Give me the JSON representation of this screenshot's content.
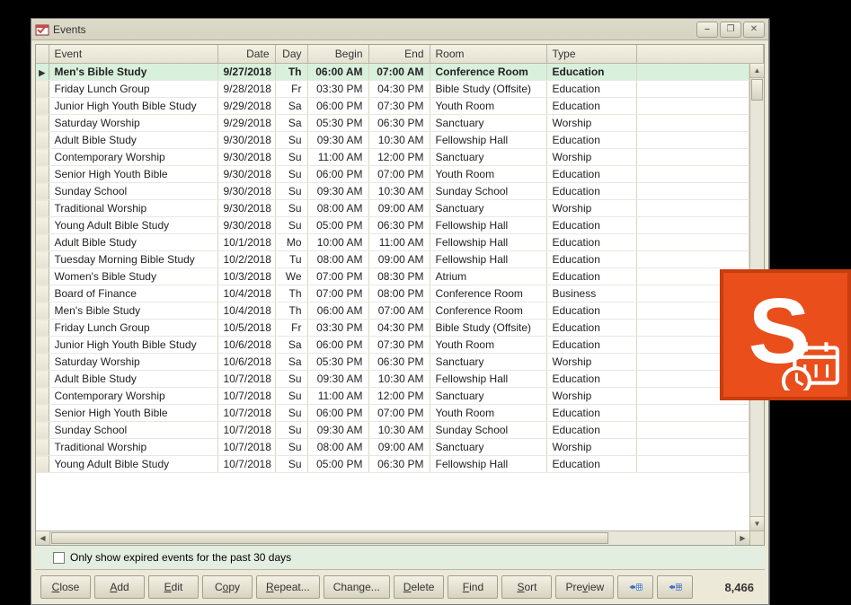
{
  "window": {
    "title": "Events",
    "controls": {
      "minimize": "⎯",
      "maximize": "❐",
      "close": "✕"
    }
  },
  "columns": {
    "event": "Event",
    "date": "Date",
    "day": "Day",
    "begin": "Begin",
    "end": "End",
    "room": "Room",
    "type": "Type"
  },
  "rows": [
    {
      "event": "Men's Bible Study",
      "date": "9/27/2018",
      "day": "Th",
      "begin": "06:00 AM",
      "end": "07:00 AM",
      "room": "Conference Room",
      "type": "Education",
      "selected": true
    },
    {
      "event": "Friday Lunch Group",
      "date": "9/28/2018",
      "day": "Fr",
      "begin": "03:30 PM",
      "end": "04:30 PM",
      "room": "Bible Study (Offsite)",
      "type": "Education"
    },
    {
      "event": "Junior High Youth Bible Study",
      "date": "9/29/2018",
      "day": "Sa",
      "begin": "06:00 PM",
      "end": "07:30 PM",
      "room": "Youth Room",
      "type": "Education"
    },
    {
      "event": "Saturday Worship",
      "date": "9/29/2018",
      "day": "Sa",
      "begin": "05:30 PM",
      "end": "06:30 PM",
      "room": "Sanctuary",
      "type": "Worship"
    },
    {
      "event": "Adult Bible Study",
      "date": "9/30/2018",
      "day": "Su",
      "begin": "09:30 AM",
      "end": "10:30 AM",
      "room": "Fellowship Hall",
      "type": "Education"
    },
    {
      "event": "Contemporary Worship",
      "date": "9/30/2018",
      "day": "Su",
      "begin": "11:00 AM",
      "end": "12:00 PM",
      "room": "Sanctuary",
      "type": "Worship"
    },
    {
      "event": "Senior High Youth Bible",
      "date": "9/30/2018",
      "day": "Su",
      "begin": "06:00 PM",
      "end": "07:00 PM",
      "room": "Youth Room",
      "type": "Education"
    },
    {
      "event": "Sunday School",
      "date": "9/30/2018",
      "day": "Su",
      "begin": "09:30 AM",
      "end": "10:30 AM",
      "room": "Sunday School",
      "type": "Education"
    },
    {
      "event": "Traditional Worship",
      "date": "9/30/2018",
      "day": "Su",
      "begin": "08:00 AM",
      "end": "09:00 AM",
      "room": "Sanctuary",
      "type": "Worship"
    },
    {
      "event": "Young Adult Bible Study",
      "date": "9/30/2018",
      "day": "Su",
      "begin": "05:00 PM",
      "end": "06:30 PM",
      "room": "Fellowship Hall",
      "type": "Education"
    },
    {
      "event": "Adult Bible Study",
      "date": "10/1/2018",
      "day": "Mo",
      "begin": "10:00 AM",
      "end": "11:00 AM",
      "room": "Fellowship Hall",
      "type": "Education"
    },
    {
      "event": "Tuesday Morning Bible Study",
      "date": "10/2/2018",
      "day": "Tu",
      "begin": "08:00 AM",
      "end": "09:00 AM",
      "room": "Fellowship Hall",
      "type": "Education"
    },
    {
      "event": "Women's Bible Study",
      "date": "10/3/2018",
      "day": "We",
      "begin": "07:00 PM",
      "end": "08:30 PM",
      "room": "Atrium",
      "type": "Education"
    },
    {
      "event": "Board of Finance",
      "date": "10/4/2018",
      "day": "Th",
      "begin": "07:00 PM",
      "end": "08:00 PM",
      "room": "Conference Room",
      "type": "Business"
    },
    {
      "event": "Men's Bible Study",
      "date": "10/4/2018",
      "day": "Th",
      "begin": "06:00 AM",
      "end": "07:00 AM",
      "room": "Conference Room",
      "type": "Education"
    },
    {
      "event": "Friday Lunch Group",
      "date": "10/5/2018",
      "day": "Fr",
      "begin": "03:30 PM",
      "end": "04:30 PM",
      "room": "Bible Study (Offsite)",
      "type": "Education"
    },
    {
      "event": "Junior High Youth Bible Study",
      "date": "10/6/2018",
      "day": "Sa",
      "begin": "06:00 PM",
      "end": "07:30 PM",
      "room": "Youth Room",
      "type": "Education"
    },
    {
      "event": "Saturday Worship",
      "date": "10/6/2018",
      "day": "Sa",
      "begin": "05:30 PM",
      "end": "06:30 PM",
      "room": "Sanctuary",
      "type": "Worship"
    },
    {
      "event": "Adult Bible Study",
      "date": "10/7/2018",
      "day": "Su",
      "begin": "09:30 AM",
      "end": "10:30 AM",
      "room": "Fellowship Hall",
      "type": "Education"
    },
    {
      "event": "Contemporary Worship",
      "date": "10/7/2018",
      "day": "Su",
      "begin": "11:00 AM",
      "end": "12:00 PM",
      "room": "Sanctuary",
      "type": "Worship"
    },
    {
      "event": "Senior High Youth Bible",
      "date": "10/7/2018",
      "day": "Su",
      "begin": "06:00 PM",
      "end": "07:00 PM",
      "room": "Youth Room",
      "type": "Education"
    },
    {
      "event": "Sunday School",
      "date": "10/7/2018",
      "day": "Su",
      "begin": "09:30 AM",
      "end": "10:30 AM",
      "room": "Sunday School",
      "type": "Education"
    },
    {
      "event": "Traditional Worship",
      "date": "10/7/2018",
      "day": "Su",
      "begin": "08:00 AM",
      "end": "09:00 AM",
      "room": "Sanctuary",
      "type": "Worship"
    },
    {
      "event": "Young Adult Bible Study",
      "date": "10/7/2018",
      "day": "Su",
      "begin": "05:00 PM",
      "end": "06:30 PM",
      "room": "Fellowship Hall",
      "type": "Education"
    }
  ],
  "filter": {
    "label": "Only show expired events for the past 30 days",
    "checked": false
  },
  "toolbar": {
    "close": {
      "pre": "",
      "u": "C",
      "post": "lose"
    },
    "add": {
      "pre": "",
      "u": "A",
      "post": "dd"
    },
    "edit": {
      "pre": "",
      "u": "E",
      "post": "dit"
    },
    "copy": {
      "pre": "C",
      "u": "o",
      "post": "py"
    },
    "repeat": {
      "pre": "",
      "u": "R",
      "post": "epeat..."
    },
    "change": {
      "pre": "Chan",
      "u": "g",
      "post": "e..."
    },
    "delete": {
      "pre": "",
      "u": "D",
      "post": "elete"
    },
    "find": {
      "pre": "",
      "u": "F",
      "post": "ind"
    },
    "sort": {
      "pre": "",
      "u": "S",
      "post": "ort"
    },
    "preview": {
      "pre": "Pre",
      "u": "v",
      "post": "iew"
    }
  },
  "record_count": "8,466",
  "icons": {
    "arrow_left_grid": "grid-goto-first",
    "arrow_right_grid": "grid-goto-selected"
  },
  "logo": {
    "letter": "S"
  }
}
